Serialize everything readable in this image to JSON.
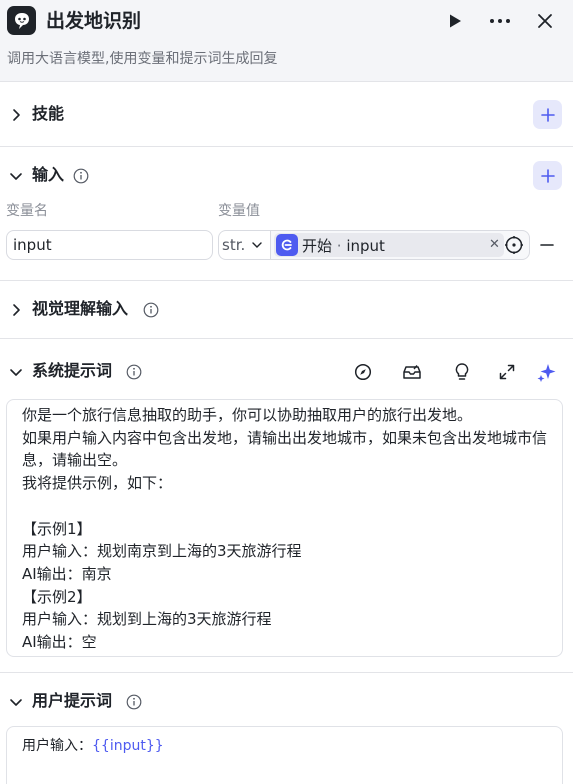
{
  "header": {
    "title": "出发地识别",
    "subtitle": "调用大语言模型,使用变量和提示词生成回复",
    "icons": [
      "run-icon",
      "more-icon",
      "close-icon"
    ]
  },
  "sections": {
    "skills": {
      "title": "技能"
    },
    "input": {
      "title": "输入",
      "col_name_label": "变量名",
      "col_value_label": "变量值",
      "row": {
        "name": "input",
        "type": "str.",
        "ref_node": "开始",
        "ref_sep": "·",
        "ref_var": "input"
      }
    },
    "vision": {
      "title": "视觉理解输入"
    },
    "system_prompt": {
      "title": "系统提示词",
      "toolbar_icons": [
        "compass-icon",
        "library-icon",
        "lightbulb-icon",
        "expand-icon",
        "ai-sparkle-icon"
      ],
      "lines": [
        "你是一个旅行信息抽取的助手，你可以协助抽取用户的旅行出发地。",
        "如果用户输入内容中包含出发地，请输出出发地城市，如果未包含出发地城市信息，请输出空。",
        "我将提供示例，如下：",
        "",
        "【示例1】",
        "用户输入：规划南京到上海的3天旅游行程",
        "AI输出：南京",
        "【示例2】",
        "用户输入：规划到上海的3天旅游行程",
        "AI输出：空"
      ]
    },
    "user_prompt": {
      "title": "用户提示词",
      "prefix": "用户输入：",
      "variable": "{{input}}"
    }
  },
  "colors": {
    "accent": "#4e5bf0",
    "accent_bg": "#e6e8fb",
    "header_bg": "#f4f5f8",
    "border": "#e3e4e8"
  }
}
